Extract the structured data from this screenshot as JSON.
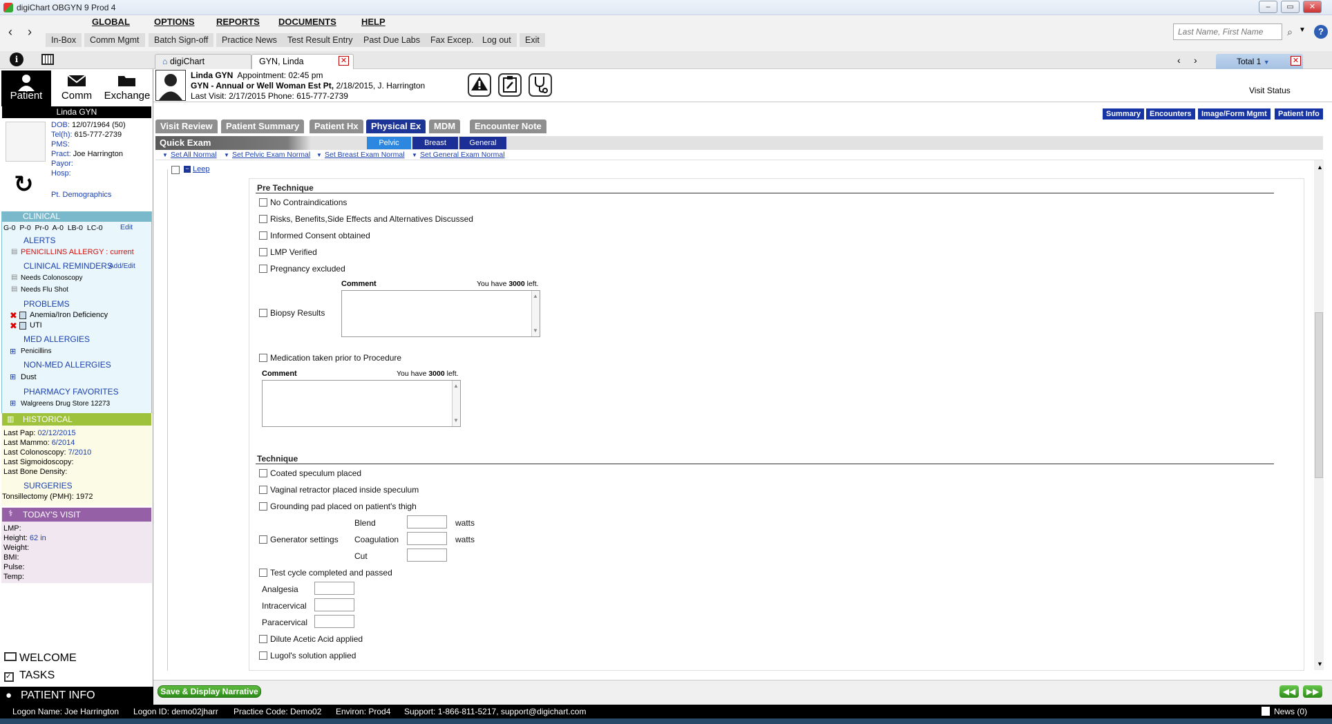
{
  "window": {
    "title": "digiChart OBGYN 9 Prod 4",
    "btns": [
      "–",
      "▭",
      "✕"
    ]
  },
  "menu": {
    "items": [
      "GLOBAL",
      "OPTIONS",
      "REPORTS",
      "DOCUMENTS",
      "HELP"
    ]
  },
  "submenu": {
    "items": [
      "In-Box",
      "Comm Mgmt",
      "Batch Sign-off",
      "Practice News",
      "Test Result Entry",
      "Past Due Labs",
      "Fax Excep.",
      "Log out",
      "Exit"
    ]
  },
  "search": {
    "placeholder": "Last Name, First Name"
  },
  "doctabs": {
    "home": "digiChart",
    "patient": "GYN, Linda",
    "total": "Total 1"
  },
  "tiles": {
    "patient": "Patient",
    "comm": "Comm",
    "exchange": "Exchange"
  },
  "patient": {
    "name": "Linda GYN",
    "dob": "12/07/1964 (50)",
    "tel": "615-777-2739",
    "pract": "Joe Harrington",
    "demographics_link": "Pt. Demographics"
  },
  "sidebar": {
    "clinical": "CLINICAL",
    "obstats": [
      "G-0",
      "P-0",
      "Pr-0",
      "A-0",
      "LB-0",
      "LC-0"
    ],
    "edit": "Edit",
    "alerts": "ALERTS",
    "alert_item": "PENICILLINS ALLERGY : current",
    "reminders": "CLINICAL REMINDERS",
    "addedit": "Add/Edit",
    "reminder_items": [
      "Needs Colonoscopy",
      "Needs Flu Shot"
    ],
    "problems": "PROBLEMS",
    "problem_items": [
      "Anemia/Iron Deficiency",
      "UTI"
    ],
    "med_allergies": "MED ALLERGIES",
    "med_allergy_item": "Penicillins",
    "nonmed_allergies": "NON-MED ALLERGIES",
    "nonmed_item": "Dust",
    "pharmacy": "PHARMACY FAVORITES",
    "pharmacy_item": "Walgreens Drug Store 12273",
    "historical": "HISTORICAL",
    "last_pap": "02/12/2015",
    "last_mammo": "6/2014",
    "last_colon": "7/2010",
    "surgeries": "SURGERIES",
    "surgery_item": "Tonsillectomy (PMH): 1972",
    "today": "TODAY'S VISIT",
    "height": "62 in"
  },
  "bottomnav": {
    "welcome": "WELCOME",
    "tasks": "TASKS",
    "patinfo": "PATIENT INFO"
  },
  "header": {
    "name": "Linda GYN",
    "appt": "Appointment: 02:45 pm",
    "visit_type": "GYN - Annual or Well Woman Est Pt,",
    "visit_detail": "2/18/2015, J. Harrington",
    "last_visit": "Last Visit: 2/17/2015   Phone: 615-777-2739",
    "visit_status": "Visit Status"
  },
  "rightbtns": [
    "Summary",
    "Encounters",
    "Image/Form Mgmt",
    "Patient Info"
  ],
  "ptabs": [
    "Visit Review",
    "Patient Summary",
    "Patient Hx",
    "Physical Ex",
    "MDM",
    "Encounter Note"
  ],
  "quick": {
    "label": "Quick Exam",
    "subtabs": [
      "Pelvic",
      "Breast",
      "General"
    ]
  },
  "normlinks": [
    "Set All Normal",
    "Set Pelvic Exam Normal",
    "Set Breast Exam Normal",
    "Set General Exam Normal"
  ],
  "form": {
    "leep": "Leep",
    "pre_technique": "Pre Technique",
    "pre_items": [
      "No Contraindications",
      "Risks, Benefits,Side Effects and Alternatives Discussed",
      "Informed Consent obtained",
      "LMP Verified",
      "Pregnancy excluded"
    ],
    "biopsy": "Biopsy Results",
    "med_taken": "Medication taken prior to Procedure",
    "comment": "Comment",
    "you_have": "You have",
    "remaining": "3000",
    "left": "left.",
    "technique": "Technique",
    "tech_items": [
      "Coated speculum placed",
      "Vaginal retractor placed inside speculum",
      "Grounding pad placed on patient's thigh"
    ],
    "generator": "Generator settings",
    "blend": "Blend",
    "coag": "Coagulation",
    "cut": "Cut",
    "watts": "watts",
    "test_cycle": "Test cycle completed and passed",
    "analgesia": "Analgesia",
    "intracervical": "Intracervical",
    "paracervical": "Paracervical",
    "dilute": "Dilute Acetic Acid applied",
    "lugols": "Lugol's solution applied"
  },
  "footer": {
    "save": "Save & Display Narrative"
  },
  "status": {
    "logon_name": "Logon Name:  Joe Harrington",
    "logon_id": "Logon ID:  demo02jharr",
    "practice": "Practice Code:  Demo02",
    "environ": "Environ:  Prod4",
    "support": "Support:  1-866-811-5217, support@digichart.com",
    "news": "News (0)"
  }
}
